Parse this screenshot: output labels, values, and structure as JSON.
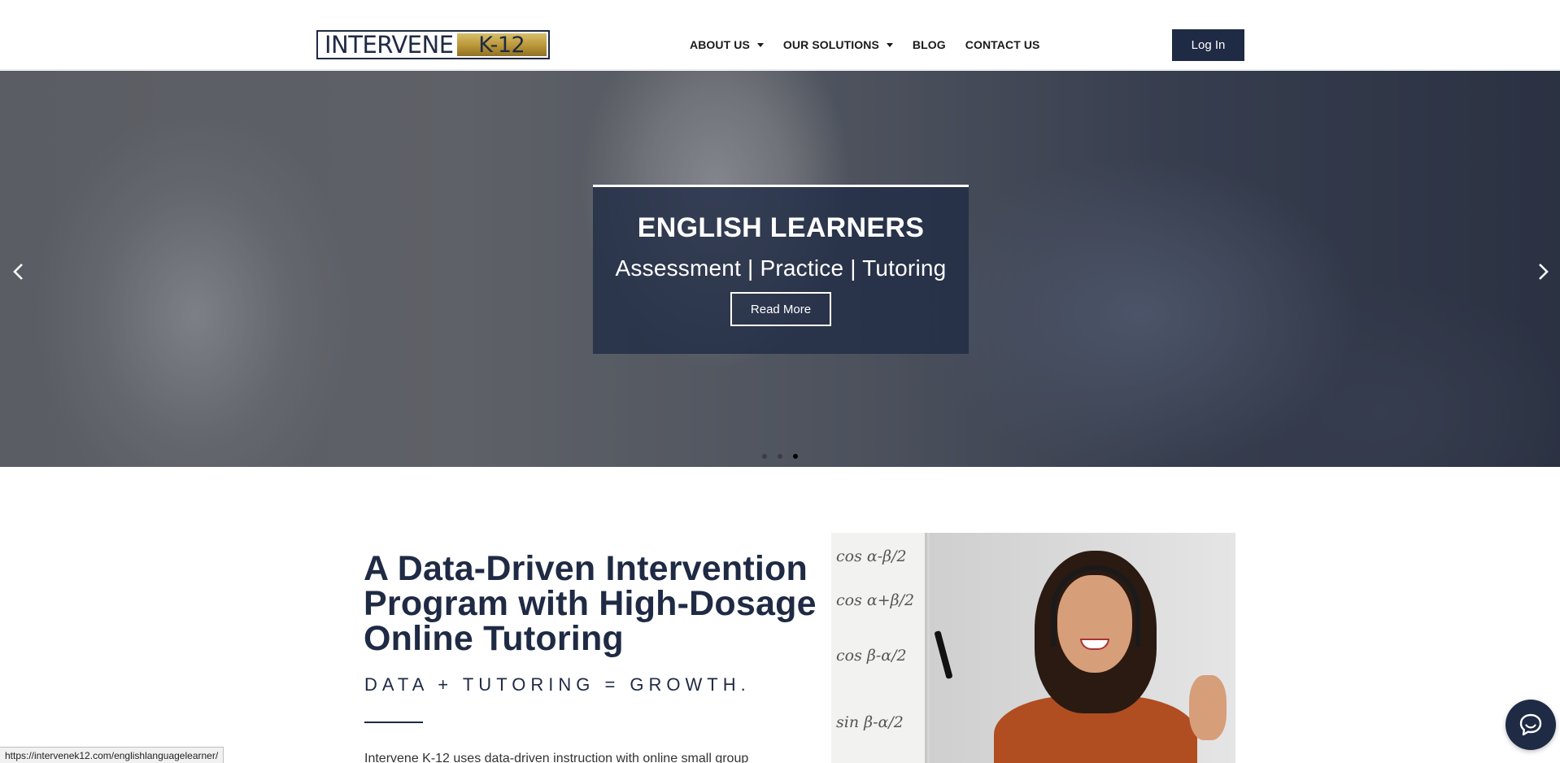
{
  "header": {
    "logo": {
      "left_text": "INTERVENE",
      "right_text": "K-12"
    },
    "nav": [
      {
        "label": "ABOUT US",
        "has_dropdown": true
      },
      {
        "label": "OUR SOLUTIONS",
        "has_dropdown": true
      },
      {
        "label": "BLOG",
        "has_dropdown": false
      },
      {
        "label": "CONTACT US",
        "has_dropdown": false
      }
    ],
    "login_label": "Log In"
  },
  "hero": {
    "title": "ENGLISH LEARNERS",
    "subtitle": "Assessment | Practice | Tutoring",
    "button_label": "Read More",
    "slide_count": 3,
    "active_slide": 3,
    "prev_icon": "chevron-left-icon",
    "next_icon": "chevron-right-icon"
  },
  "intro": {
    "headline": "A Data-Driven Intervention Program with High-Dosage Online Tutoring",
    "tagline": "DATA + TUTORING = GROWTH.",
    "body": "Intervene K-12 uses data-driven instruction with online small group"
  },
  "photo_board": {
    "formulas": [
      "cos α-β/2",
      "cos α+β/2",
      "cos β-α/2",
      "sin β-α/2"
    ]
  },
  "chat": {
    "icon": "chat-bubble-icon"
  },
  "statusbar": {
    "url": "https://intervenek12.com/englishlanguagelearner/"
  },
  "misc": {
    "corner_mark": "`"
  },
  "colors": {
    "navy": "#1f2a44",
    "gold": "#b99536",
    "white": "#ffffff"
  }
}
